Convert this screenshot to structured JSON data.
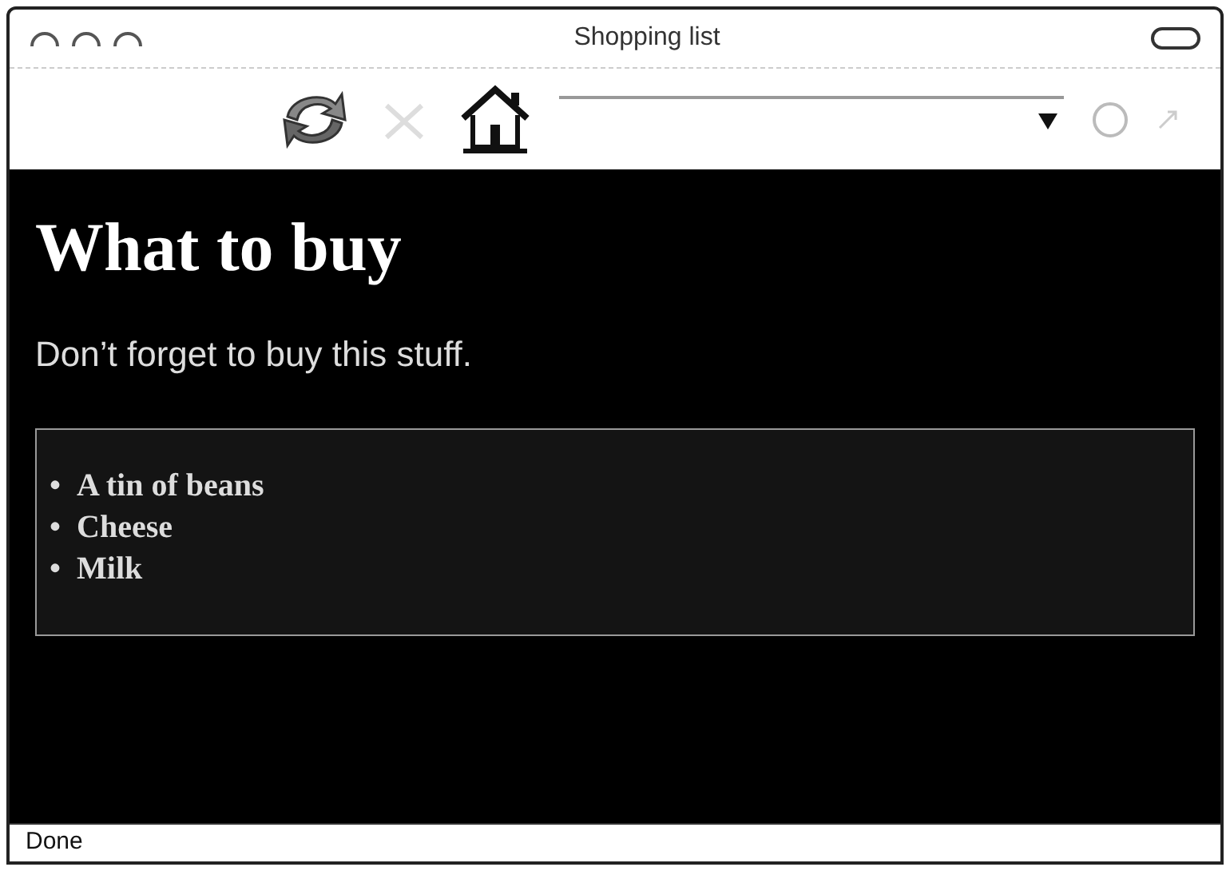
{
  "window": {
    "title": "Shopping list"
  },
  "page": {
    "heading": "What to buy",
    "intro": "Don’t forget to buy this stuff.",
    "items": [
      {
        "bullet": "•",
        "text": "A tin of beans"
      },
      {
        "bullet": "•",
        "text": "Cheese"
      },
      {
        "bullet": "•",
        "text": "Milk"
      }
    ]
  },
  "status_bar": "Done"
}
